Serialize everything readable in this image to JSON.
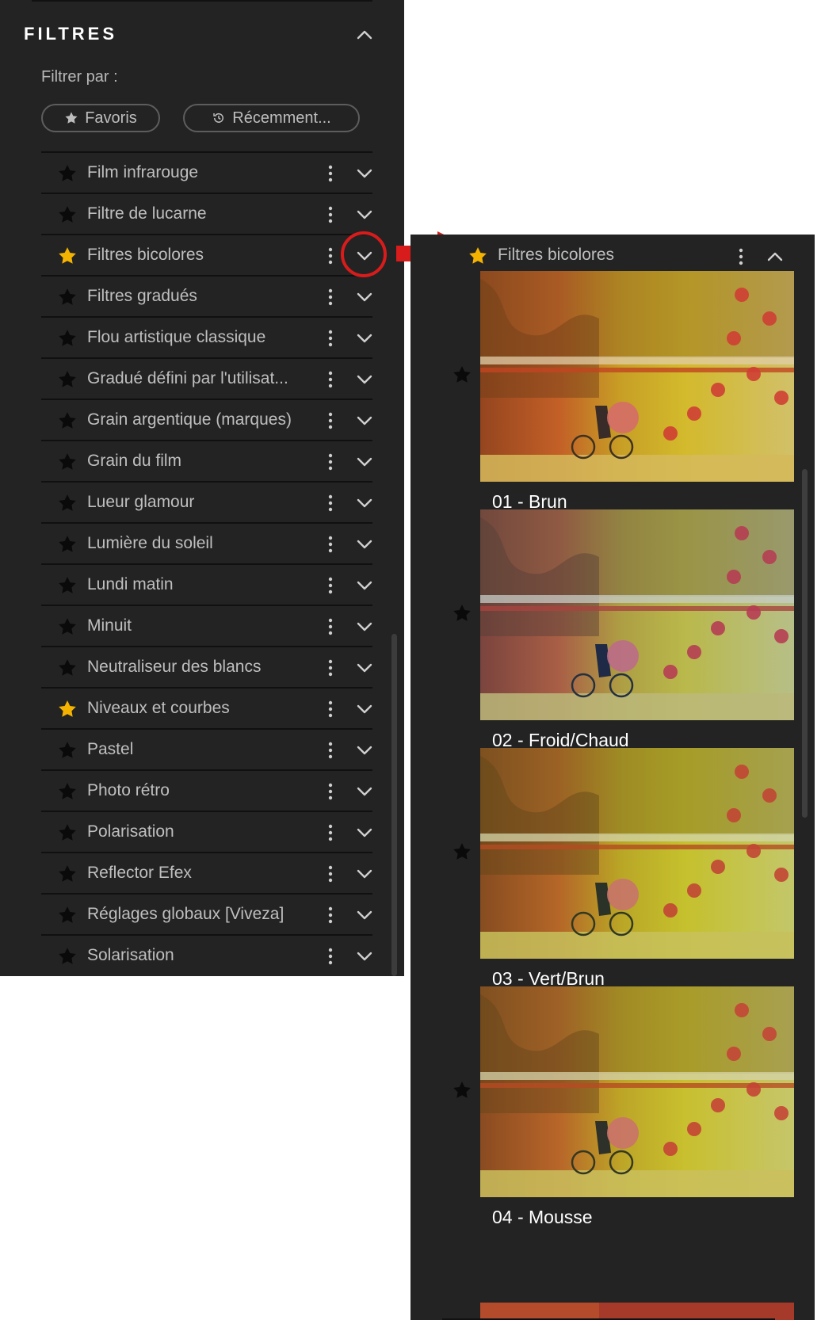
{
  "left_panel": {
    "title": "FILTRES",
    "filter_by_label": "Filtrer par :",
    "chips": {
      "favorites": "Favoris",
      "recent": "Récemment..."
    },
    "items": [
      {
        "label": "Film infrarouge",
        "favorite": false
      },
      {
        "label": "Filtre de lucarne",
        "favorite": false
      },
      {
        "label": "Filtres bicolores",
        "favorite": true
      },
      {
        "label": "Filtres gradués",
        "favorite": false
      },
      {
        "label": "Flou artistique classique",
        "favorite": false
      },
      {
        "label": "Gradué défini par l'utilisat...",
        "favorite": false
      },
      {
        "label": "Grain argentique (marques)",
        "favorite": false
      },
      {
        "label": "Grain du film",
        "favorite": false
      },
      {
        "label": "Lueur glamour",
        "favorite": false
      },
      {
        "label": "Lumière du soleil",
        "favorite": false
      },
      {
        "label": "Lundi matin",
        "favorite": false
      },
      {
        "label": "Minuit",
        "favorite": false
      },
      {
        "label": "Neutraliseur des blancs",
        "favorite": false
      },
      {
        "label": "Niveaux et courbes",
        "favorite": true
      },
      {
        "label": "Pastel",
        "favorite": false
      },
      {
        "label": "Photo rétro",
        "favorite": false
      },
      {
        "label": "Polarisation",
        "favorite": false
      },
      {
        "label": "Reflector Efex",
        "favorite": false
      },
      {
        "label": "Réglages globaux [Viveza]",
        "favorite": false
      },
      {
        "label": "Solarisation",
        "favorite": false
      }
    ]
  },
  "right_panel": {
    "header_title": "Filtres bicolores",
    "header_favorite": true,
    "presets": [
      {
        "name": "01 - Brun",
        "tint": "#c8781c"
      },
      {
        "name": "02 - Froid/Chaud",
        "tint": "#3a72c8"
      },
      {
        "name": "03 - Vert/Brun",
        "tint": "#7aa020"
      },
      {
        "name": "04 - Mousse",
        "tint": "#8a9a28"
      }
    ]
  },
  "colors": {
    "panel_bg": "#232323",
    "star_favorite": "#f5b301",
    "star_default": "#0a0a0a",
    "annotation_red": "#d81c1c"
  }
}
